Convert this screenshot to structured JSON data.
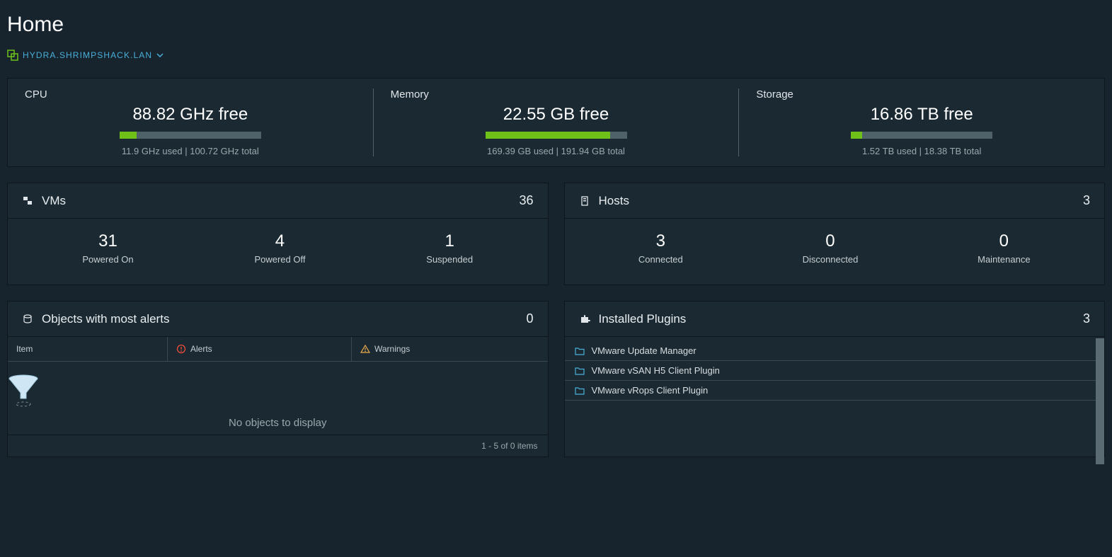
{
  "page": {
    "title": "Home"
  },
  "breadcrumb": {
    "host": "HYDRA.SHRIMPSHACK.LAN"
  },
  "resources": {
    "cpu": {
      "label": "CPU",
      "free": "88.82 GHz free",
      "detail": "11.9 GHz used | 100.72 GHz total",
      "used_pct": 12
    },
    "memory": {
      "label": "Memory",
      "free": "22.55 GB free",
      "detail": "169.39 GB used | 191.94 GB total",
      "used_pct": 88
    },
    "storage": {
      "label": "Storage",
      "free": "16.86 TB free",
      "detail": "1.52 TB used | 18.38 TB total",
      "used_pct": 8
    }
  },
  "vms": {
    "title": "VMs",
    "total": "36",
    "powered_on": {
      "count": "31",
      "label": "Powered On"
    },
    "powered_off": {
      "count": "4",
      "label": "Powered Off"
    },
    "suspended": {
      "count": "1",
      "label": "Suspended"
    }
  },
  "hosts": {
    "title": "Hosts",
    "total": "3",
    "connected": {
      "count": "3",
      "label": "Connected"
    },
    "disconnected": {
      "count": "0",
      "label": "Disconnected"
    },
    "maintenance": {
      "count": "0",
      "label": "Maintenance"
    }
  },
  "alerts": {
    "title": "Objects with most alerts",
    "total": "0",
    "cols": {
      "item": "Item",
      "alerts": "Alerts",
      "warnings": "Warnings"
    },
    "empty": "No objects to display",
    "pager": "1 - 5 of 0 items"
  },
  "plugins": {
    "title": "Installed Plugins",
    "total": "3",
    "items": [
      "VMware Update Manager",
      "VMware vSAN H5 Client Plugin",
      "VMware vRops Client Plugin"
    ]
  }
}
